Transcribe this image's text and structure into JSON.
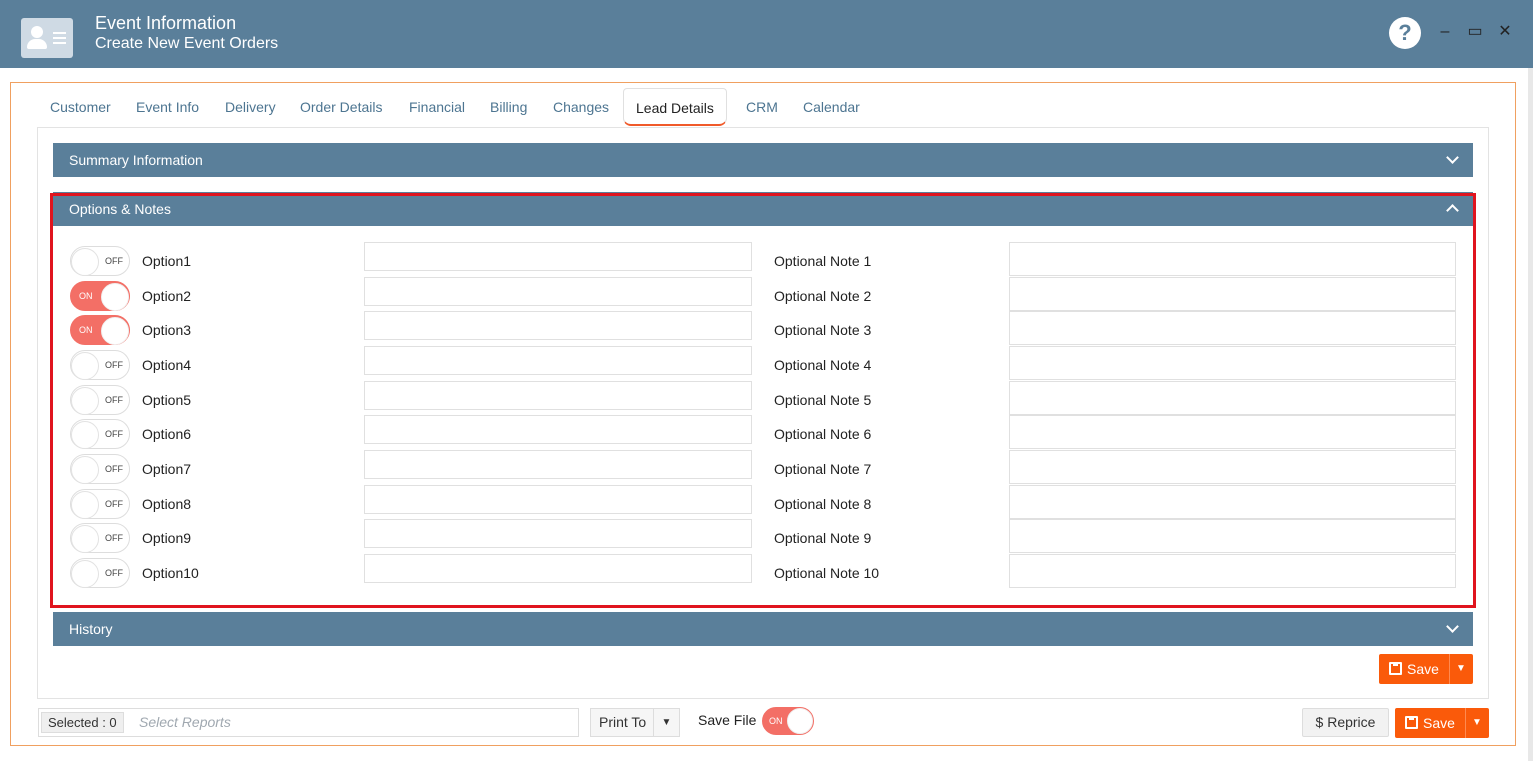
{
  "window": {
    "title": "Event Information",
    "subtitle": "Create New Event Orders",
    "help_label": "?",
    "minimize_label": "–",
    "maximize_label": "▭",
    "close_label": "✕"
  },
  "tabs": [
    {
      "label": "Customer"
    },
    {
      "label": "Event Info"
    },
    {
      "label": "Delivery"
    },
    {
      "label": "Order Details"
    },
    {
      "label": "Financial"
    },
    {
      "label": "Billing"
    },
    {
      "label": "Changes"
    },
    {
      "label": "Lead Details",
      "active": true
    },
    {
      "label": "CRM"
    },
    {
      "label": "Calendar"
    }
  ],
  "panels": {
    "summary": {
      "title": "Summary Information"
    },
    "options": {
      "title": "Options & Notes"
    },
    "history": {
      "title": "History"
    }
  },
  "options": [
    {
      "label": "Option1",
      "state": "OFF",
      "value": "",
      "note_label": "Optional Note 1",
      "note_value": ""
    },
    {
      "label": "Option2",
      "state": "ON",
      "value": "",
      "note_label": "Optional Note 2",
      "note_value": ""
    },
    {
      "label": "Option3",
      "state": "ON",
      "value": "",
      "note_label": "Optional Note 3",
      "note_value": ""
    },
    {
      "label": "Option4",
      "state": "OFF",
      "value": "",
      "note_label": "Optional Note 4",
      "note_value": ""
    },
    {
      "label": "Option5",
      "state": "OFF",
      "value": "",
      "note_label": "Optional Note 5",
      "note_value": ""
    },
    {
      "label": "Option6",
      "state": "OFF",
      "value": "",
      "note_label": "Optional Note 6",
      "note_value": ""
    },
    {
      "label": "Option7",
      "state": "OFF",
      "value": "",
      "note_label": "Optional Note 7",
      "note_value": ""
    },
    {
      "label": "Option8",
      "state": "OFF",
      "value": "",
      "note_label": "Optional Note 8",
      "note_value": ""
    },
    {
      "label": "Option9",
      "state": "OFF",
      "value": "",
      "note_label": "Optional Note 9",
      "note_value": ""
    },
    {
      "label": "Option10",
      "state": "OFF",
      "value": "",
      "note_label": "Optional Note 10",
      "note_value": ""
    }
  ],
  "actions": {
    "save_label": "Save",
    "dropdown_caret": "▼"
  },
  "footer": {
    "selected_label": "Selected : 0",
    "select_reports_placeholder": "Select Reports",
    "print_to_label": "Print To",
    "print_to_caret": "▼",
    "save_file_label": "Save File",
    "save_file_state": "ON",
    "reprice_label": "$  Reprice",
    "save_label": "Save",
    "save_caret": "▼"
  },
  "colors": {
    "header": "#5a7f9a",
    "accent": "#fa5a0a",
    "toggle_on": "#f36f66",
    "highlight": "#e0141e"
  }
}
